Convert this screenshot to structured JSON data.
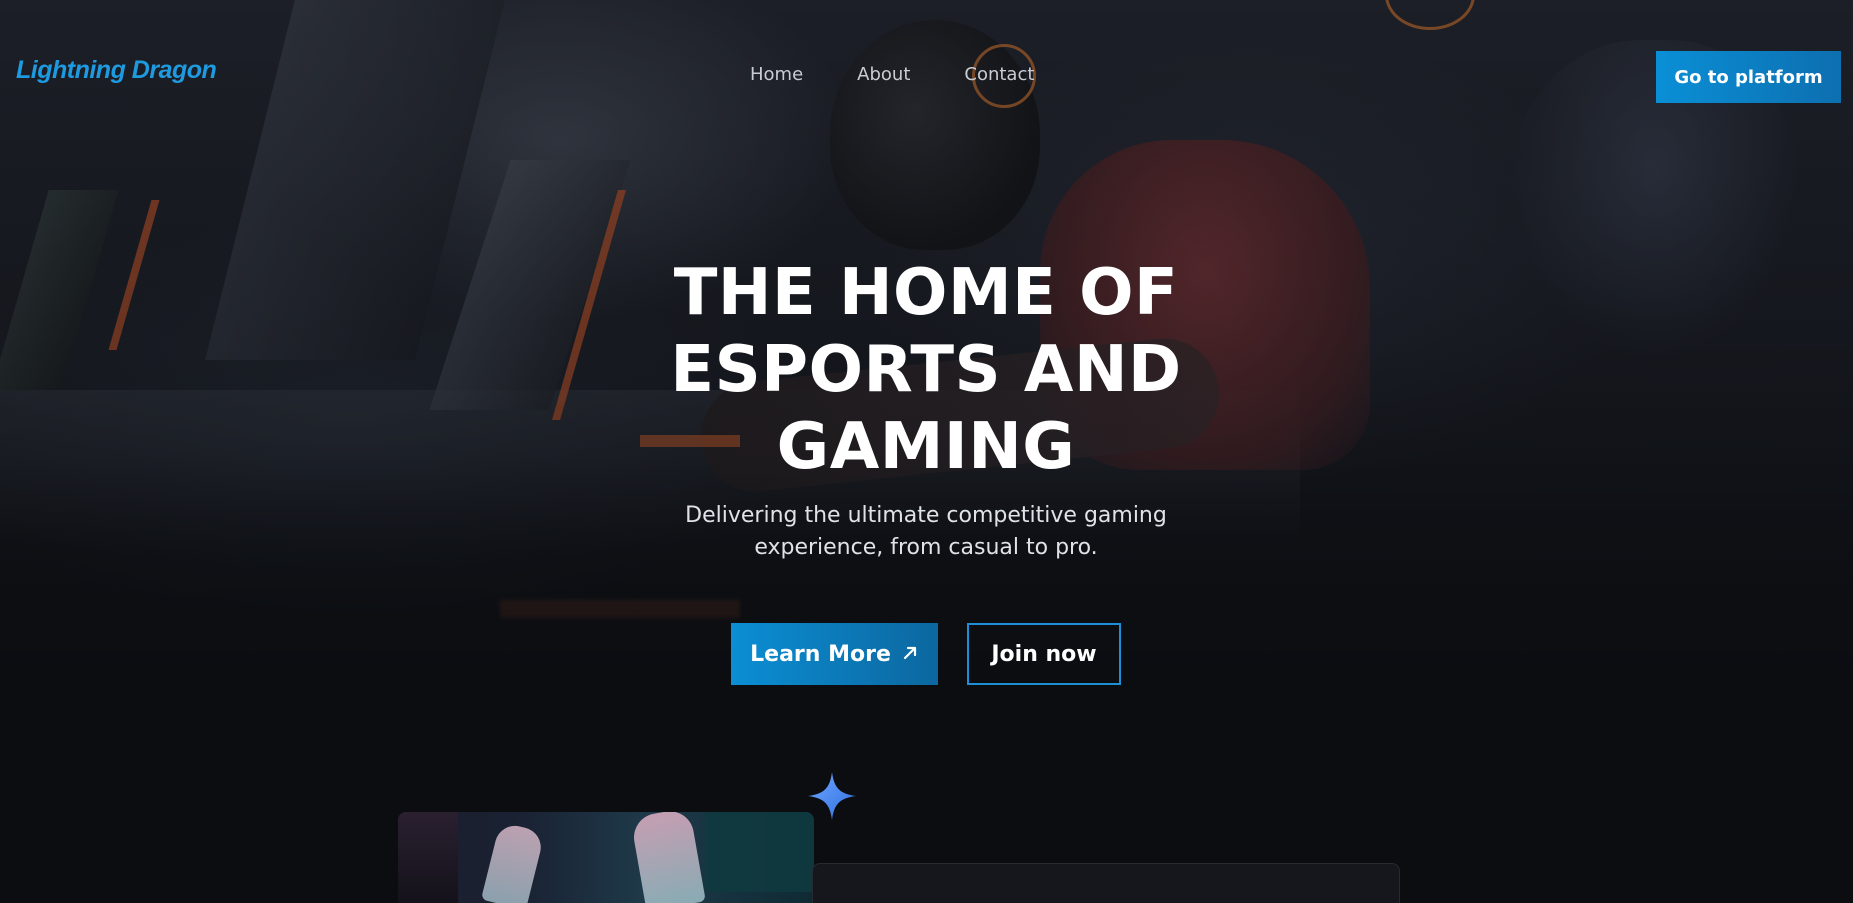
{
  "brand": {
    "logo_text": "Lightning Dragon",
    "accent_color": "#1e9be0",
    "button_gradient": [
      "#0a8fd6",
      "#0d6fb0"
    ]
  },
  "nav": {
    "links": [
      {
        "label": "Home"
      },
      {
        "label": "About"
      },
      {
        "label": "Contact"
      }
    ],
    "cta_label": "Go to platform"
  },
  "hero": {
    "title_lines": [
      "THE HOME OF",
      "ESPORTS AND",
      "GAMING"
    ],
    "subtitle_lines": [
      "Delivering the ultimate competitive gaming",
      "experience, from casual to pro."
    ],
    "primary_button": {
      "label": "Learn More",
      "icon": "arrow-up-right-icon"
    },
    "secondary_button": {
      "label": "Join now"
    }
  },
  "section": {
    "decor_icon": "sparkle-icon"
  }
}
